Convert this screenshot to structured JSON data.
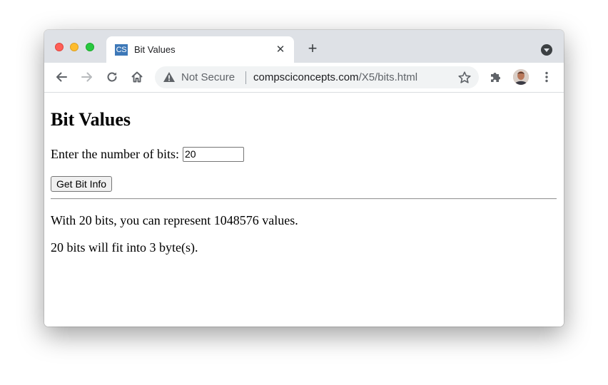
{
  "browser": {
    "tab": {
      "favicon_text": "CS",
      "title": "Bit Values",
      "close_glyph": "✕"
    },
    "new_tab_glyph": "+",
    "address_bar": {
      "security_label": "Not Secure",
      "url_host": "compsciconcepts.com",
      "url_path": "/X5/bits.html"
    },
    "icons": {
      "back": "back-arrow-icon",
      "forward": "forward-arrow-icon",
      "reload": "reload-icon",
      "home": "home-icon",
      "warning": "warning-triangle-icon",
      "bookmark": "star-icon",
      "extensions": "puzzle-icon",
      "profile": "avatar",
      "menu": "kebab-menu-icon",
      "tab_search": "tab-search-icon"
    },
    "colors": {
      "tab_strip": "#dee1e6",
      "omnibox": "#f1f3f4",
      "favicon": "#3d78b8",
      "close_light": "#ff5f57",
      "minimize_light": "#febc2e",
      "maximize_light": "#28c840"
    }
  },
  "page": {
    "heading": "Bit Values",
    "input_label": "Enter the number of bits:",
    "input_value": "20",
    "button_label": "Get Bit Info",
    "result_values": "With 20 bits, you can represent 1048576 values.",
    "result_bytes": "20 bits will fit into 3 byte(s)."
  }
}
